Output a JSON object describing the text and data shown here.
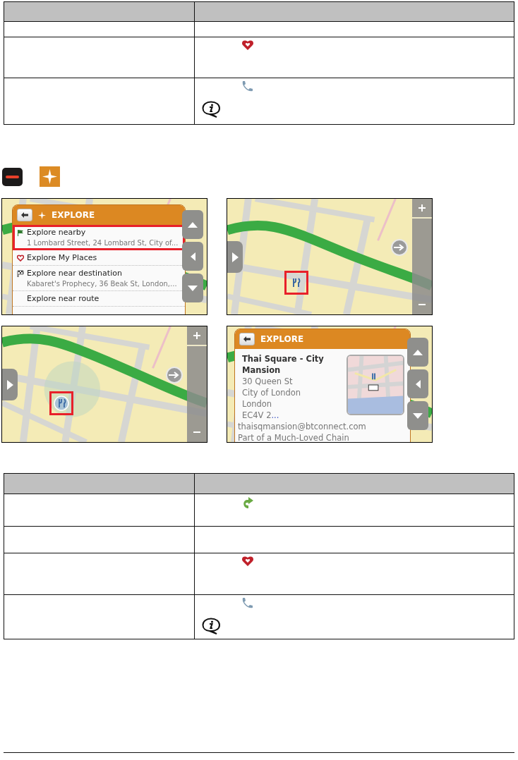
{
  "table_1": {
    "rows": [
      {
        "kind": "blank"
      },
      {
        "kind": "favourite"
      },
      {
        "kind": "call"
      }
    ]
  },
  "step_icons": [
    {
      "kind": "minus"
    },
    {
      "kind": "explore"
    }
  ],
  "screens": [
    {
      "kind": "menu",
      "title": "EXPLORE",
      "title_star": true,
      "items": [
        {
          "kind": "flag",
          "label": "Explore nearby",
          "detail": "1 Lombard Street, 24 Lombard St, City of...",
          "selected": true
        },
        {
          "kind": "heart",
          "label": "Explore My Places",
          "selected": false
        },
        {
          "kind": "checkered-flag",
          "label": "Explore near destination",
          "detail": "Kabaret's Prophecy, 36 Beak St, London,...",
          "selected": false
        },
        {
          "kind": "plain",
          "label": "Explore near route",
          "selected": false
        }
      ]
    },
    {
      "kind": "map",
      "pin": false,
      "highlighted": true
    },
    {
      "kind": "map",
      "pin": true,
      "highlighted": true
    },
    {
      "kind": "details",
      "title": "EXPLORE",
      "title_star": false,
      "name": "Thai Square - City Mansion",
      "address": [
        "30 Queen St",
        "City of London",
        "London",
        "EC4V 2"
      ],
      "more": "...",
      "email": "thaisqmansion@btconnect.com",
      "note": "Part of a Much-Loved Chain"
    }
  ],
  "table_2": {
    "rows": [
      {
        "kind": "detour"
      },
      {
        "kind": "blank"
      },
      {
        "kind": "favourite"
      },
      {
        "kind": "call"
      }
    ]
  }
}
